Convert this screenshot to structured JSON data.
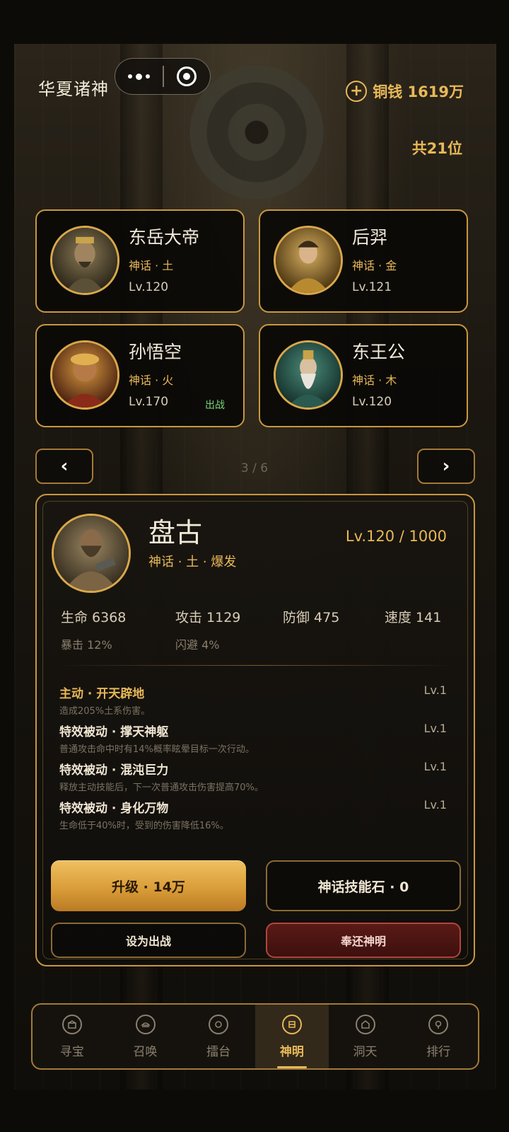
{
  "header": {
    "title": "华夏诸神",
    "coins_label": "铜钱 1619万",
    "total_label": "共21位"
  },
  "deities": [
    {
      "name": "东岳大帝",
      "tags": "神话 · 土",
      "level": "Lv.120",
      "deploy": ""
    },
    {
      "name": "后羿",
      "tags": "神话 · 金",
      "level": "Lv.121",
      "deploy": ""
    },
    {
      "name": "孙悟空",
      "tags": "神话 · 火",
      "level": "Lv.170",
      "deploy": "出战"
    },
    {
      "name": "东王公",
      "tags": "神话 · 木",
      "level": "Lv.120",
      "deploy": ""
    }
  ],
  "pager": {
    "prev": "‹",
    "next": "›",
    "indicator": "3 / 6"
  },
  "detail": {
    "name": "盘古",
    "tags": "神话 · 土 · 爆发",
    "level": "Lv.120 / 1000",
    "stats": {
      "hp": "生命 6368",
      "atk": "攻击 1129",
      "def": "防御 475",
      "spd": "速度 141",
      "crit": "暴击 12%",
      "dodge": "闪避 4%"
    },
    "skills": [
      {
        "title": "主动 · 开天辟地",
        "desc": "造成205%土系伤害。",
        "level": "Lv.1"
      },
      {
        "title": "特效被动 · 撑天神躯",
        "desc": "普通攻击命中时有14%概率眩晕目标一次行动。",
        "level": "Lv.1"
      },
      {
        "title": "特效被动 · 混沌巨力",
        "desc": "释放主动技能后，下一次普通攻击伤害提高70%。",
        "level": "Lv.1"
      },
      {
        "title": "特效被动 · 身化万物",
        "desc": "生命低于40%时，受到的伤害降低16%。",
        "level": "Lv.1"
      }
    ],
    "buttons": {
      "upgrade": "升级 · 14万",
      "skill_stone": "神话技能石 · 0",
      "deploy": "设为出战",
      "return": "奉还神明"
    }
  },
  "tabs": [
    {
      "label": "寻宝",
      "active": false
    },
    {
      "label": "召唤",
      "active": false
    },
    {
      "label": "擂台",
      "active": false
    },
    {
      "label": "神明",
      "active": true
    },
    {
      "label": "洞天",
      "active": false
    },
    {
      "label": "排行",
      "active": false
    }
  ],
  "colors": {
    "accent": "#e8b858",
    "card_border": "#c9973f",
    "deploy_green": "#7bd67a",
    "return_red": "#5a1a16"
  }
}
